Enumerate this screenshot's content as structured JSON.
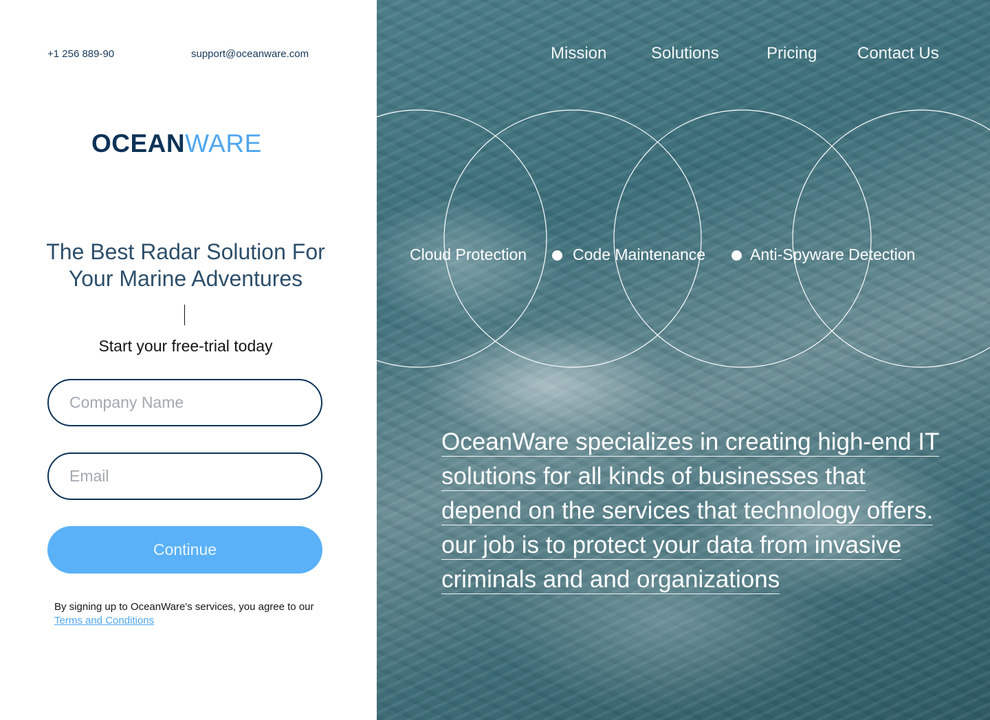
{
  "contact": {
    "phone": "+1 256 889-90",
    "email": "support@oceanware.com"
  },
  "brand": {
    "logo_part1": "OCEAN",
    "logo_part2": "WARE",
    "colors": {
      "navy": "#0d3357",
      "sky": "#4fa6ee",
      "button": "#5ab1f8"
    }
  },
  "hero": {
    "headline": "The Best Radar Solution For Your Marine Adventures",
    "subheadline": "Start your free-trial today"
  },
  "form": {
    "company_placeholder": "Company Name",
    "company_value": "",
    "email_placeholder": "Email",
    "email_value": "",
    "continue_label": "Continue",
    "legal_text": "By signing up to OceanWare's services, you agree to our",
    "terms_link": "Terms and Conditions"
  },
  "nav": {
    "items": [
      {
        "label": "Mission"
      },
      {
        "label": "Solutions"
      },
      {
        "label": "Pricing"
      },
      {
        "label": "Contact Us"
      }
    ]
  },
  "features": [
    {
      "label": "Cloud Protection"
    },
    {
      "label": "Code Maintenance"
    },
    {
      "label": "Anti-Spyware Detection"
    }
  ],
  "about": {
    "text": "OceanWare specializes in creating high-end IT solutions for all kinds of businesses that depend on the services that technology offers. our job is to protect your data from invasive criminals and and organizations"
  }
}
